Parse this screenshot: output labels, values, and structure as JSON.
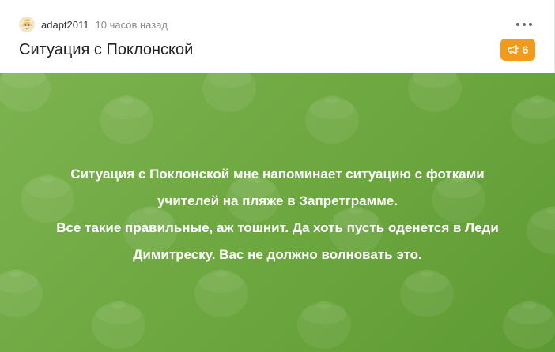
{
  "post": {
    "author": "adapt2011",
    "time": "10 часов назад",
    "title": "Ситуация с Поклонской",
    "badge_count": "6",
    "body_lines": [
      "Ситуация с Поклонской мне напоминает ситуацию с фотками",
      "учителей на пляже в Запретграмме.",
      "Все такие правильные, аж тошнит. Да хоть пусть оденется в Леди",
      "Димитреску. Вас не должно волновать это."
    ]
  },
  "icons": {
    "avatar": "avatar-icon",
    "more": "more-horizontal-icon",
    "badge": "megaphone-icon"
  },
  "colors": {
    "badge": "#f39a1b",
    "image_bg_start": "#7cb350",
    "image_bg_end": "#5e9a33",
    "meta_text": "#8a8a8a"
  }
}
